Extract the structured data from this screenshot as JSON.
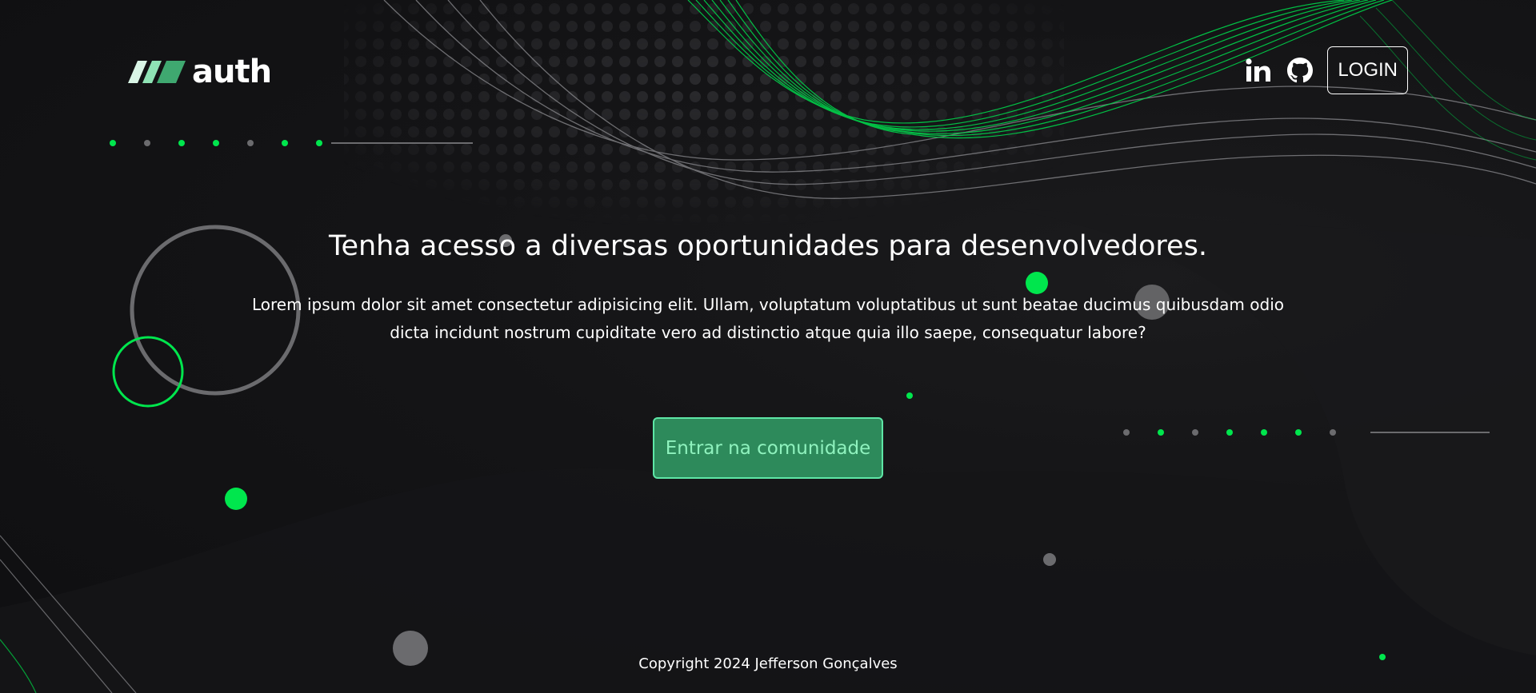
{
  "brand": {
    "logo_text": "auth",
    "logo_icon": "triple-slash-logo",
    "accent_color": "#00e64d",
    "accent_soft": "#5ee6a6",
    "button_fill": "#2d8a5b"
  },
  "header": {
    "linkedin_icon": "linkedin-icon",
    "github_icon": "github-icon",
    "login_label": "LOGIN"
  },
  "hero": {
    "title": "Tenha acesso a diversas oportunidades para desenvolvedores.",
    "description": "Lorem ipsum dolor sit amet consectetur adipisicing elit. Ullam, voluptatum voluptatibus ut sunt beatae ducimus quibusdam odio dicta incidunt nostrum cupiditate vero ad distinctio atque quia illo saepe, consequatur labore?",
    "cta_label": "Entrar na comunidade"
  },
  "footer": {
    "copyright": "Copyright 2024 Jefferson Gonçalves"
  }
}
